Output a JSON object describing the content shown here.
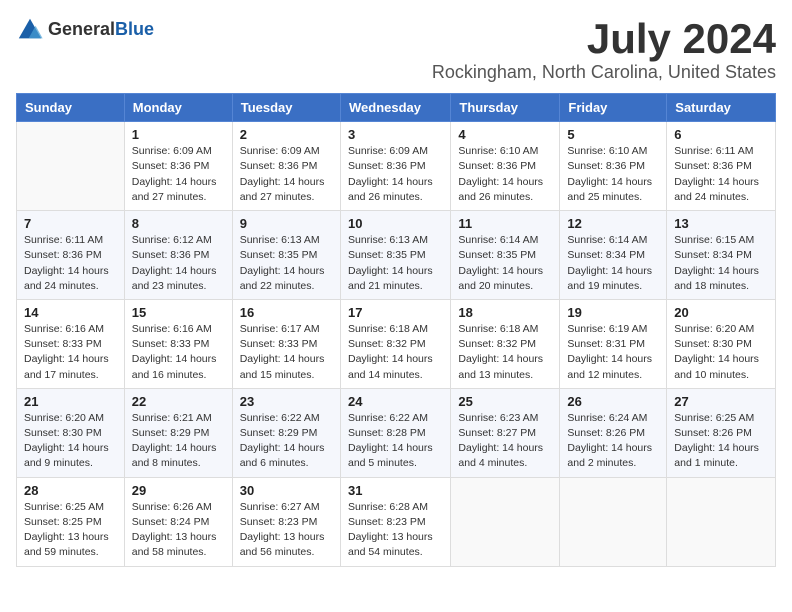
{
  "logo": {
    "text_general": "General",
    "text_blue": "Blue"
  },
  "title": "July 2024",
  "location": "Rockingham, North Carolina, United States",
  "weekdays": [
    "Sunday",
    "Monday",
    "Tuesday",
    "Wednesday",
    "Thursday",
    "Friday",
    "Saturday"
  ],
  "weeks": [
    [
      {
        "day": "",
        "info": ""
      },
      {
        "day": "1",
        "info": "Sunrise: 6:09 AM\nSunset: 8:36 PM\nDaylight: 14 hours\nand 27 minutes."
      },
      {
        "day": "2",
        "info": "Sunrise: 6:09 AM\nSunset: 8:36 PM\nDaylight: 14 hours\nand 27 minutes."
      },
      {
        "day": "3",
        "info": "Sunrise: 6:09 AM\nSunset: 8:36 PM\nDaylight: 14 hours\nand 26 minutes."
      },
      {
        "day": "4",
        "info": "Sunrise: 6:10 AM\nSunset: 8:36 PM\nDaylight: 14 hours\nand 26 minutes."
      },
      {
        "day": "5",
        "info": "Sunrise: 6:10 AM\nSunset: 8:36 PM\nDaylight: 14 hours\nand 25 minutes."
      },
      {
        "day": "6",
        "info": "Sunrise: 6:11 AM\nSunset: 8:36 PM\nDaylight: 14 hours\nand 24 minutes."
      }
    ],
    [
      {
        "day": "7",
        "info": "Sunrise: 6:11 AM\nSunset: 8:36 PM\nDaylight: 14 hours\nand 24 minutes."
      },
      {
        "day": "8",
        "info": "Sunrise: 6:12 AM\nSunset: 8:36 PM\nDaylight: 14 hours\nand 23 minutes."
      },
      {
        "day": "9",
        "info": "Sunrise: 6:13 AM\nSunset: 8:35 PM\nDaylight: 14 hours\nand 22 minutes."
      },
      {
        "day": "10",
        "info": "Sunrise: 6:13 AM\nSunset: 8:35 PM\nDaylight: 14 hours\nand 21 minutes."
      },
      {
        "day": "11",
        "info": "Sunrise: 6:14 AM\nSunset: 8:35 PM\nDaylight: 14 hours\nand 20 minutes."
      },
      {
        "day": "12",
        "info": "Sunrise: 6:14 AM\nSunset: 8:34 PM\nDaylight: 14 hours\nand 19 minutes."
      },
      {
        "day": "13",
        "info": "Sunrise: 6:15 AM\nSunset: 8:34 PM\nDaylight: 14 hours\nand 18 minutes."
      }
    ],
    [
      {
        "day": "14",
        "info": "Sunrise: 6:16 AM\nSunset: 8:33 PM\nDaylight: 14 hours\nand 17 minutes."
      },
      {
        "day": "15",
        "info": "Sunrise: 6:16 AM\nSunset: 8:33 PM\nDaylight: 14 hours\nand 16 minutes."
      },
      {
        "day": "16",
        "info": "Sunrise: 6:17 AM\nSunset: 8:33 PM\nDaylight: 14 hours\nand 15 minutes."
      },
      {
        "day": "17",
        "info": "Sunrise: 6:18 AM\nSunset: 8:32 PM\nDaylight: 14 hours\nand 14 minutes."
      },
      {
        "day": "18",
        "info": "Sunrise: 6:18 AM\nSunset: 8:32 PM\nDaylight: 14 hours\nand 13 minutes."
      },
      {
        "day": "19",
        "info": "Sunrise: 6:19 AM\nSunset: 8:31 PM\nDaylight: 14 hours\nand 12 minutes."
      },
      {
        "day": "20",
        "info": "Sunrise: 6:20 AM\nSunset: 8:30 PM\nDaylight: 14 hours\nand 10 minutes."
      }
    ],
    [
      {
        "day": "21",
        "info": "Sunrise: 6:20 AM\nSunset: 8:30 PM\nDaylight: 14 hours\nand 9 minutes."
      },
      {
        "day": "22",
        "info": "Sunrise: 6:21 AM\nSunset: 8:29 PM\nDaylight: 14 hours\nand 8 minutes."
      },
      {
        "day": "23",
        "info": "Sunrise: 6:22 AM\nSunset: 8:29 PM\nDaylight: 14 hours\nand 6 minutes."
      },
      {
        "day": "24",
        "info": "Sunrise: 6:22 AM\nSunset: 8:28 PM\nDaylight: 14 hours\nand 5 minutes."
      },
      {
        "day": "25",
        "info": "Sunrise: 6:23 AM\nSunset: 8:27 PM\nDaylight: 14 hours\nand 4 minutes."
      },
      {
        "day": "26",
        "info": "Sunrise: 6:24 AM\nSunset: 8:26 PM\nDaylight: 14 hours\nand 2 minutes."
      },
      {
        "day": "27",
        "info": "Sunrise: 6:25 AM\nSunset: 8:26 PM\nDaylight: 14 hours\nand 1 minute."
      }
    ],
    [
      {
        "day": "28",
        "info": "Sunrise: 6:25 AM\nSunset: 8:25 PM\nDaylight: 13 hours\nand 59 minutes."
      },
      {
        "day": "29",
        "info": "Sunrise: 6:26 AM\nSunset: 8:24 PM\nDaylight: 13 hours\nand 58 minutes."
      },
      {
        "day": "30",
        "info": "Sunrise: 6:27 AM\nSunset: 8:23 PM\nDaylight: 13 hours\nand 56 minutes."
      },
      {
        "day": "31",
        "info": "Sunrise: 6:28 AM\nSunset: 8:23 PM\nDaylight: 13 hours\nand 54 minutes."
      },
      {
        "day": "",
        "info": ""
      },
      {
        "day": "",
        "info": ""
      },
      {
        "day": "",
        "info": ""
      }
    ]
  ]
}
